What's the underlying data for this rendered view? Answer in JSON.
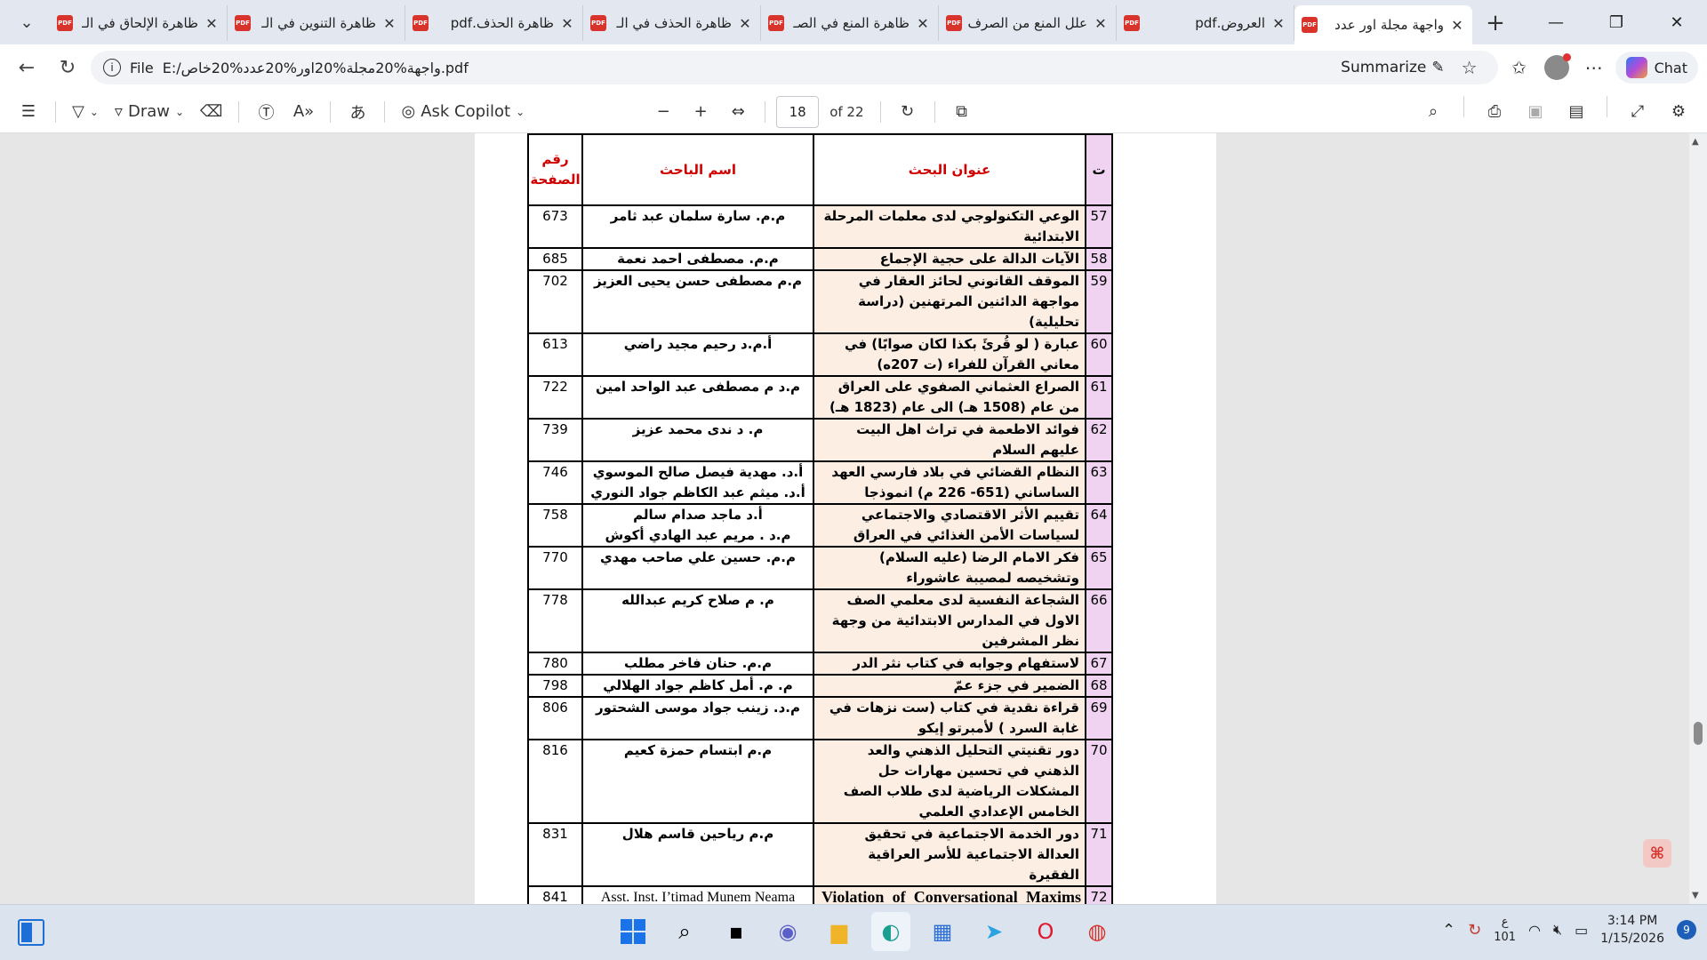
{
  "browser": {
    "tabs": [
      {
        "title": "ظاهرة الإلحاق في الـ",
        "active": false
      },
      {
        "title": "ظاهرة التنوين في الـ",
        "active": false
      },
      {
        "title": "ظاهرة الحذف.pdf",
        "active": false
      },
      {
        "title": "ظاهرة الحذف في الـ",
        "active": false
      },
      {
        "title": "ظاهرة المنع في الصـ",
        "active": false
      },
      {
        "title": "علل المنع من الصرف",
        "active": false
      },
      {
        "title": "العروض.pdf",
        "active": false
      },
      {
        "title": "واجهة مجلة اور عدد",
        "active": true
      }
    ],
    "address": {
      "scheme": "File",
      "url": "E:/واجهة%20مجلة%20اور%20عدد%20خاص.pdf",
      "summarize_label": "Summarize",
      "chat_label": "Chat"
    }
  },
  "pdf_toolbar": {
    "draw_label": "Draw",
    "copilot_label": "Ask Copilot",
    "page_current": "18",
    "page_total": "of 22"
  },
  "toc": {
    "headers": {
      "num": "ت",
      "title": "عنوان البحث",
      "researcher": "اسم الباحث",
      "page": "رقم الصفحة"
    },
    "rows": [
      {
        "num": "57",
        "title": "الوعي التكنولوجي لدى معلمات المرحلة الابتدائية",
        "researcher": "م.م. سارة سلمان عبد ثامر",
        "page": "673"
      },
      {
        "num": "58",
        "title": "الآيات الدالة على حجية الإجماع",
        "researcher": "م.م. مصطفى احمد نعمة",
        "page": "685"
      },
      {
        "num": "59",
        "title": "الموقف القانوني لحائز العقار في مواجهة الدائنين المرتهنين (دراسة تحليلية)",
        "researcher": "م.م مصطفى حسن يحيى العزيز",
        "page": "702"
      },
      {
        "num": "60",
        "title": "عبارة ( لو قُرئَ بكذا لكان صوابًا) في معاني القرآن للفراء (ت 207ه)",
        "researcher": "أ.م.د رحيم مجيد راضي",
        "page": "613"
      },
      {
        "num": "61",
        "title": "الصراع العثماني الصفوي على العراق من عام (1508 هـ) الى عام (1823 هـ)",
        "researcher": "م.د م مصطفى عبد الواحد امين",
        "page": "722"
      },
      {
        "num": "62",
        "title": "فوائد الاطعمة في تراث اهل البيت عليهم السلام",
        "researcher": "م. د ندى محمد عزيز",
        "page": "739"
      },
      {
        "num": "63",
        "title": "النظام القضائي في بلاد فارسي العهد الساساني (651- 226 م) انموذجا",
        "researcher": "أ.د. مهدية فيصل صالح الموسوي\nأ.د. ميثم عبد الكاظم جواد النوري",
        "page": "746"
      },
      {
        "num": "64",
        "title": "تقييم الأثر الاقتصادي والاجتماعي لسياسات الأمن الغذائي في العراق",
        "researcher": "أ.د ماجد صدام سالم\nم.د . مريم عبد الهادي أكوش",
        "page": "758"
      },
      {
        "num": "65",
        "title": "فكر الامام الرضا (عليه السلام) وتشخيصه لمصيبة عاشوراء",
        "researcher": "م.م. حسين علي صاحب مهدي",
        "page": "770"
      },
      {
        "num": "66",
        "title": "الشجاعة النفسية لدى معلمي الصف الاول في المدارس الابتدائية من وجهة نظر المشرفين",
        "researcher": "م. م صلاح كريم عبدالله",
        "page": "778"
      },
      {
        "num": "67",
        "title": "لاستفهام وجوابه في كتاب نثر الدر",
        "researcher": "م.م. حنان فاخر مطلب",
        "page": "780"
      },
      {
        "num": "68",
        "title": "الضمير في جزء عمّ",
        "researcher": "م. م. أمل كاظم جواد الهلالي",
        "page": "798"
      },
      {
        "num": "69",
        "title": "قراءة نقدية في كتاب (ست نزهات في غابة السرد ) لأمبرتو إيكو",
        "researcher": "م.د. زينب جواد موسى الشحتور",
        "page": "806"
      },
      {
        "num": "70",
        "title": "دور تقنيتي التحليل الذهني والعد الذهني في تحسين مهارات حل المشكلات الرياضية لدى طلاب الصف الخامس الإعدادي العلمي",
        "researcher": "م.م ابتسام حمزة كعيم",
        "page": "816"
      },
      {
        "num": "71",
        "title": "دور الخدمة الاجتماعية في تحقيق العدالة الاجتماعية للأسر العراقية الفقيرة",
        "researcher": "م.م رياحين قاسم هلال",
        "page": "831"
      },
      {
        "num": "72",
        "title": "Violation of Conversational Maxims in the Selected Plays of Edgar Allan Poe",
        "researcher": "Asst. Inst. I’timad Munem Neama",
        "page": "841",
        "english": true
      }
    ]
  },
  "taskbar": {
    "lang_top": "ع",
    "lang_bottom": "101",
    "time": "3:14 PM",
    "date": "1/15/2026",
    "notifications": "9"
  }
}
